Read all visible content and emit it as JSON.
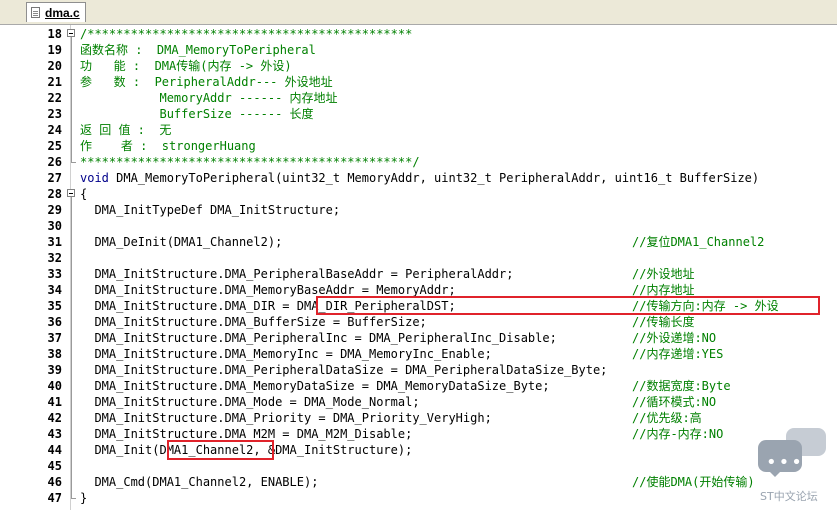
{
  "tab": {
    "label": "dma.c",
    "icon": "file-icon"
  },
  "lines": [
    {
      "n": "18",
      "code": "/*********************************************",
      "comment": "",
      "type": "comment"
    },
    {
      "n": "19",
      "code": "函数名称 :  DMA_MemoryToPeripheral",
      "comment": "",
      "type": "comment"
    },
    {
      "n": "20",
      "code": "功   能 :  DMA传输(内存 -> 外设)",
      "comment": "",
      "type": "comment"
    },
    {
      "n": "21",
      "code": "参   数 :  PeripheralAddr--- 外设地址",
      "comment": "",
      "type": "comment"
    },
    {
      "n": "22",
      "code": "           MemoryAddr ------ 内存地址",
      "comment": "",
      "type": "comment"
    },
    {
      "n": "23",
      "code": "           BufferSize ------ 长度",
      "comment": "",
      "type": "comment"
    },
    {
      "n": "24",
      "code": "返 回 值 :  无",
      "comment": "",
      "type": "comment"
    },
    {
      "n": "25",
      "code": "作    者 :  strongerHuang",
      "comment": "",
      "type": "comment"
    },
    {
      "n": "26",
      "code": "**********************************************/",
      "comment": "",
      "type": "comment"
    },
    {
      "n": "27",
      "code": "void DMA_MemoryToPeripheral(uint32_t MemoryAddr, uint32_t PeripheralAddr, uint16_t BufferSize)",
      "comment": "",
      "type": "code"
    },
    {
      "n": "28",
      "code": "{",
      "comment": "",
      "type": "code"
    },
    {
      "n": "29",
      "code": "  DMA_InitTypeDef DMA_InitStructure;",
      "comment": "",
      "type": "code"
    },
    {
      "n": "30",
      "code": "",
      "comment": "",
      "type": "code"
    },
    {
      "n": "31",
      "code": "  DMA_DeInit(DMA1_Channel2);",
      "comment": "//复位DMA1_Channel2",
      "type": "code"
    },
    {
      "n": "32",
      "code": "",
      "comment": "",
      "type": "code"
    },
    {
      "n": "33",
      "code": "  DMA_InitStructure.DMA_PeripheralBaseAddr = PeripheralAddr;",
      "comment": "//外设地址",
      "type": "code"
    },
    {
      "n": "34",
      "code": "  DMA_InitStructure.DMA_MemoryBaseAddr = MemoryAddr;",
      "comment": "//内存地址",
      "type": "code"
    },
    {
      "n": "35",
      "code": "  DMA_InitStructure.DMA_DIR = DMA_DIR_PeripheralDST;",
      "comment": "//传输方向:内存 -> 外设",
      "type": "code"
    },
    {
      "n": "36",
      "code": "  DMA_InitStructure.DMA_BufferSize = BufferSize;",
      "comment": "//传输长度",
      "type": "code"
    },
    {
      "n": "37",
      "code": "  DMA_InitStructure.DMA_PeripheralInc = DMA_PeripheralInc_Disable;",
      "comment": "//外设递增:NO",
      "type": "code"
    },
    {
      "n": "38",
      "code": "  DMA_InitStructure.DMA_MemoryInc = DMA_MemoryInc_Enable;",
      "comment": "//内存递增:YES",
      "type": "code"
    },
    {
      "n": "39",
      "code": "  DMA_InitStructure.DMA_PeripheralDataSize = DMA_PeripheralDataSize_Byte;",
      "comment": "",
      "type": "code"
    },
    {
      "n": "40",
      "code": "  DMA_InitStructure.DMA_MemoryDataSize = DMA_MemoryDataSize_Byte;",
      "comment": "//数据宽度:Byte",
      "type": "code"
    },
    {
      "n": "41",
      "code": "  DMA_InitStructure.DMA_Mode = DMA_Mode_Normal;",
      "comment": "//循环模式:NO",
      "type": "code"
    },
    {
      "n": "42",
      "code": "  DMA_InitStructure.DMA_Priority = DMA_Priority_VeryHigh;",
      "comment": "//优先级:高",
      "type": "code"
    },
    {
      "n": "43",
      "code": "  DMA_InitStructure.DMA_M2M = DMA_M2M_Disable;",
      "comment": "//内存-内存:NO",
      "type": "code"
    },
    {
      "n": "44",
      "code": "  DMA_Init(DMA1_Channel2, &DMA_InitStructure);",
      "comment": "",
      "type": "code"
    },
    {
      "n": "45",
      "code": "",
      "comment": "",
      "type": "code"
    },
    {
      "n": "46",
      "code": "  DMA_Cmd(DMA1_Channel2, ENABLE);",
      "comment": "//使能DMA(开始传输)",
      "type": "code"
    },
    {
      "n": "47",
      "code": "}",
      "comment": "",
      "type": "code"
    }
  ],
  "watermark": {
    "text": "ST中文论坛",
    "icon": "chat-bubble-icon"
  },
  "colors": {
    "highlight": "#e0232b",
    "comment": "#008000",
    "keyword": "#00008b"
  }
}
